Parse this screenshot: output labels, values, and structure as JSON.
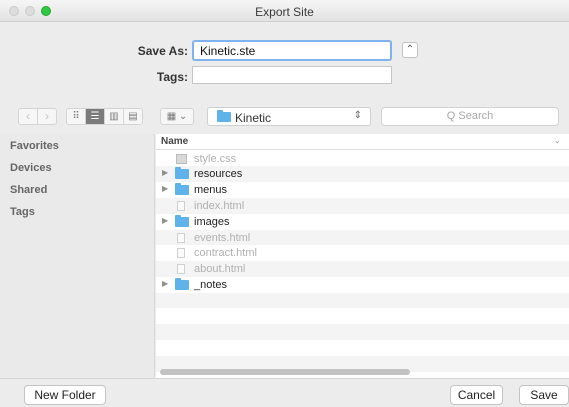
{
  "window": {
    "title": "Export Site"
  },
  "form": {
    "save_as_label": "Save As:",
    "save_as_value": "Kinetic.ste",
    "tags_label": "Tags:",
    "tags_value": "",
    "expand_glyph": "⌃"
  },
  "toolbar": {
    "back_glyph": "‹",
    "forward_glyph": "›",
    "view_icons_glyph": "⠿",
    "view_list_glyph": "☰",
    "view_columns_glyph": "▥",
    "view_cover_glyph": "▤",
    "arrange_glyph": "▦ ⌄",
    "location": "Kinetic",
    "location_stepper": "⇕",
    "search_placeholder": "Q Search",
    "accent_folder_color": "#5fb2ea"
  },
  "sidebar": {
    "items": [
      "Favorites",
      "Devices",
      "Shared",
      "Tags"
    ]
  },
  "filelist": {
    "column_name": "Name",
    "column_chevron": "⌄",
    "rows": [
      {
        "name": "style.css",
        "kind": "css",
        "enabled": false
      },
      {
        "name": "resources",
        "kind": "folder",
        "enabled": true
      },
      {
        "name": "menus",
        "kind": "folder",
        "enabled": true
      },
      {
        "name": "index.html",
        "kind": "file",
        "enabled": false
      },
      {
        "name": "images",
        "kind": "folder",
        "enabled": true
      },
      {
        "name": "events.html",
        "kind": "file",
        "enabled": false
      },
      {
        "name": "contract.html",
        "kind": "file",
        "enabled": false
      },
      {
        "name": "about.html",
        "kind": "file",
        "enabled": false
      },
      {
        "name": "_notes",
        "kind": "folder",
        "enabled": true
      }
    ]
  },
  "buttons": {
    "new_folder": "New Folder",
    "cancel": "Cancel",
    "save": "Save"
  }
}
